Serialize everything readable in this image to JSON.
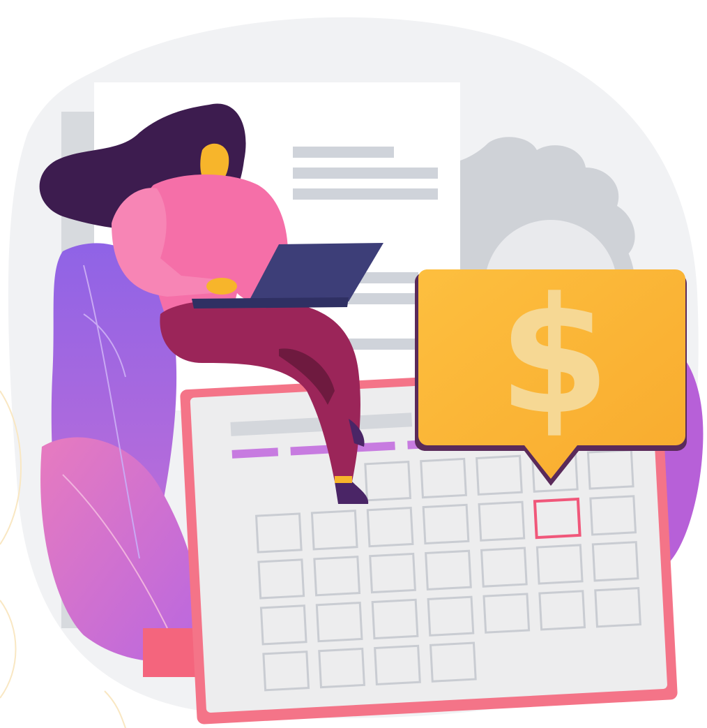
{
  "illustration": {
    "bubble_symbol": "$",
    "palette": {
      "blob": "#f1f2f4",
      "paper": "#ffffff",
      "paper_lines": "#cfd3da",
      "gear": "#cfd2d7",
      "calendar_frame": "#f47488",
      "calendar_face": "#ededee",
      "calendar_cell": "#c9ccd2",
      "calendar_highlight": "#f0577a",
      "weekday_bar": "#c77be0",
      "bubble": "#fdb93a",
      "bubble_symbol": "#f6d894",
      "hair": "#3d1c4f",
      "skin": "#f7b52b",
      "sweater": "#f56fa8",
      "pants": "#9b2559",
      "shoes": "#4a2566",
      "laptop": "#3d3e78",
      "foliage_purple": "#9066e8",
      "foliage_pink": "#e07ac0"
    },
    "icons": [
      "gear-icon",
      "calendar-icon",
      "dollar-sign-icon",
      "laptop-icon"
    ]
  }
}
